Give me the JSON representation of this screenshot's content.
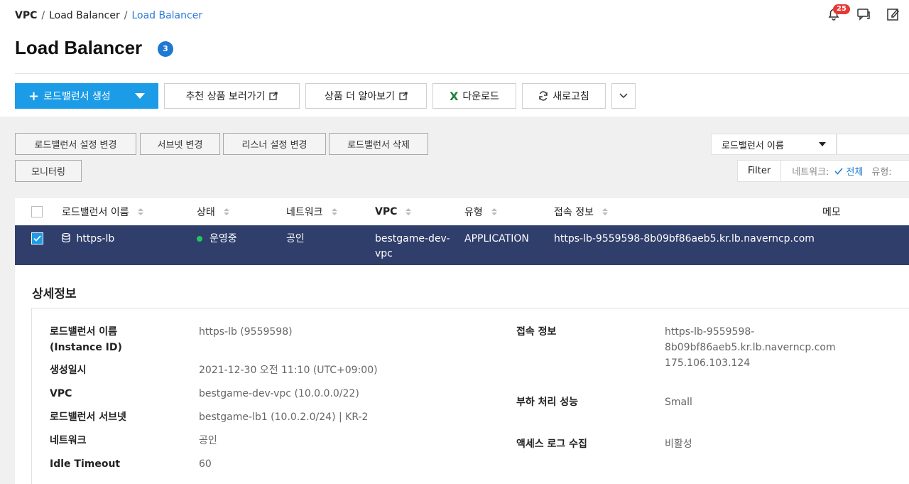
{
  "breadcrumb": {
    "first": "VPC",
    "second": "Load Balancer",
    "third": "Load Balancer",
    "sep": "/"
  },
  "header": {
    "title": "Load Balancer",
    "count": "3",
    "notifications": "25"
  },
  "toolbar": {
    "create": "로드밸런서 생성",
    "recommend": "추천 상품 보러가기",
    "learn_more": "상품 더 알아보기",
    "download": "다운로드",
    "refresh": "새로고침"
  },
  "actions": {
    "change_settings": "로드밸런서 설정 변경",
    "change_subnet": "서브넷 변경",
    "change_listener": "리스너 설정 변경",
    "delete": "로드밸런서 삭제",
    "monitoring": "모니터링"
  },
  "search": {
    "select_value": "로드밸런서 이름"
  },
  "filter": {
    "label": "Filter",
    "network_key": "네트워크:",
    "network_value": "전체",
    "type_key": "유형:"
  },
  "table": {
    "headers": {
      "name": "로드밸런서 이름",
      "status": "상태",
      "network": "네트워크",
      "vpc": "VPC",
      "type": "유형",
      "access": "접속 정보",
      "memo": "메모"
    },
    "row": {
      "name": "https-lb",
      "status": "운영중",
      "network": "공인",
      "vpc_line1": "bestgame-dev-",
      "vpc_line2": "vpc",
      "type": "APPLICATION",
      "access": "https-lb-9559598-8b09bf86aeb5.kr.lb.naverncp.com"
    }
  },
  "detail": {
    "title": "상세정보",
    "name_label_1": "로드밸런서 이름",
    "name_label_2": "(Instance ID)",
    "name_value": "https-lb (9559598)",
    "created_label": "생성일시",
    "created_value": "2021-12-30 오전 11:10 (UTC+09:00)",
    "vpc_label": "VPC",
    "vpc_value": "bestgame-dev-vpc (10.0.0.0/22)",
    "subnet_label": "로드밸런서 서브넷",
    "subnet_value": "bestgame-lb1 (10.0.2.0/24) | KR-2",
    "network_label": "네트워크",
    "network_value": "공인",
    "idle_label": "Idle Timeout",
    "idle_value": "60",
    "access_label": "접속 정보",
    "access_value_1": "https-lb-9559598-8b09bf86aeb5.kr.lb.naverncp.com",
    "access_value_2": "175.106.103.124",
    "perf_label": "부하 처리 성능",
    "perf_value": "Small",
    "log_label": "액세스 로그 수집",
    "log_value": "비활성"
  },
  "colors": {
    "primary": "#1c9ce7",
    "selected_row": "#2f3e6b",
    "link": "#2a7ad6",
    "status_ok": "#22c55e"
  }
}
